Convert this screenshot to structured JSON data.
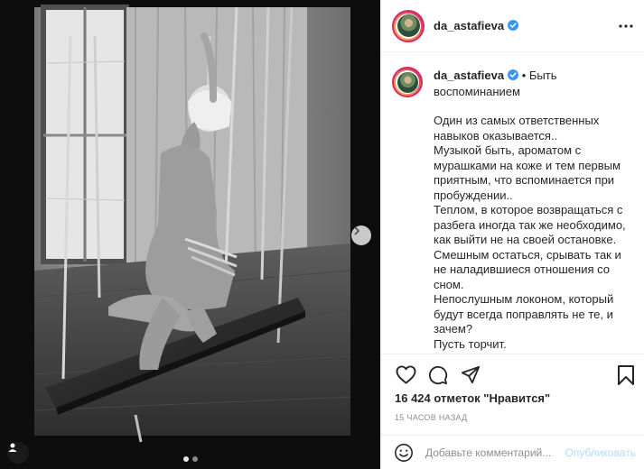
{
  "post": {
    "username": "da_astafieva",
    "caption_title": "Быть воспоминанием",
    "caption_body": "Один из самых ответственных навыков оказывается..\nМузыкой быть, ароматом с мурашками на коже и тем первым приятным, что вспоминается при пробуждении..\nТеплом, в которое возвращаться с разбега иногда так же необходимо, как выйти не на своей остановке.\nСмешным остаться, срывать так и не наладившиеся отношения со сном.\nНепослушным локоном, который будут всегда поправлять не те, и зачем?\nПусть торчит.\nПредателем быть, который уходя не оглядывается.",
    "likes_text": "16 424 отметок \"Нравится\"",
    "time_text": "15 ЧАСОВ НАЗАД",
    "separator": "•"
  },
  "comment": {
    "placeholder": "Добавьте комментарий...",
    "publish_label": "Опубликовать"
  },
  "carousel": {
    "total": 2,
    "active": 1
  },
  "icons": {
    "more": "more-options-icon",
    "like": "heart-icon",
    "comment": "comment-bubble-icon",
    "share": "paper-plane-icon",
    "save": "bookmark-icon",
    "emoji": "smiley-icon",
    "next": "chevron-right-icon",
    "tag": "user-tag-icon",
    "verified": "verified-badge-icon"
  },
  "colors": {
    "verified": "#3897f0",
    "publish": "#b3dbff",
    "story_ring": "#d6286a"
  }
}
